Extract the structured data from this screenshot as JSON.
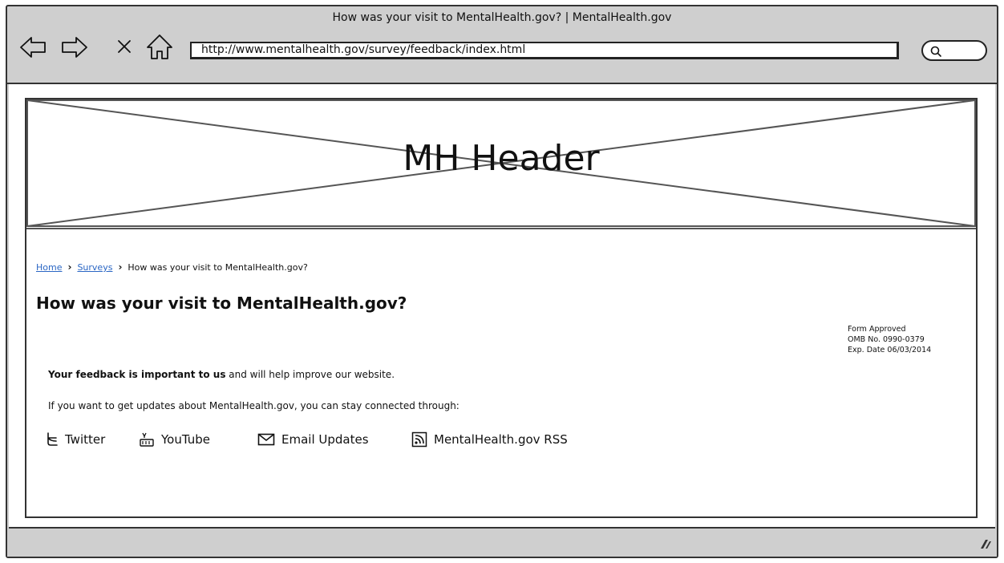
{
  "window": {
    "title": "How was your visit to MentalHealth.gov? | MentalHealth.gov"
  },
  "toolbar": {
    "back_icon": "back-arrow-icon",
    "forward_icon": "forward-arrow-icon",
    "stop_icon": "close-icon",
    "home_icon": "home-icon",
    "url": "http://www.mentalhealth.gov/survey/feedback/index.html",
    "search_icon": "search-icon"
  },
  "header": {
    "placeholder_label": "MH Header"
  },
  "breadcrumb": {
    "items": [
      "Home",
      "Surveys"
    ],
    "current": "How was your visit to MentalHealth.gov?"
  },
  "main": {
    "title": "How was your visit to MentalHealth.gov?",
    "omb": {
      "line1": "Form Approved",
      "line2": "OMB No. 0990-0379",
      "line3": "Exp. Date 06/03/2014"
    },
    "feedback": {
      "bold": "Your feedback is important to us",
      "rest": " and will help improve our website."
    },
    "updates_text": "If you want to get updates about MentalHealth.gov, you can stay connected through:",
    "social_links": [
      {
        "label": "Twitter",
        "icon": "twitter-icon"
      },
      {
        "label": "YouTube",
        "icon": "youtube-icon"
      },
      {
        "label": "Email Updates",
        "icon": "email-icon"
      },
      {
        "label": "MentalHealth.gov RSS",
        "icon": "rss-icon"
      }
    ]
  },
  "colors": {
    "link": "#2a66c4",
    "chrome": "#cfcfcf",
    "ink": "#111111"
  }
}
